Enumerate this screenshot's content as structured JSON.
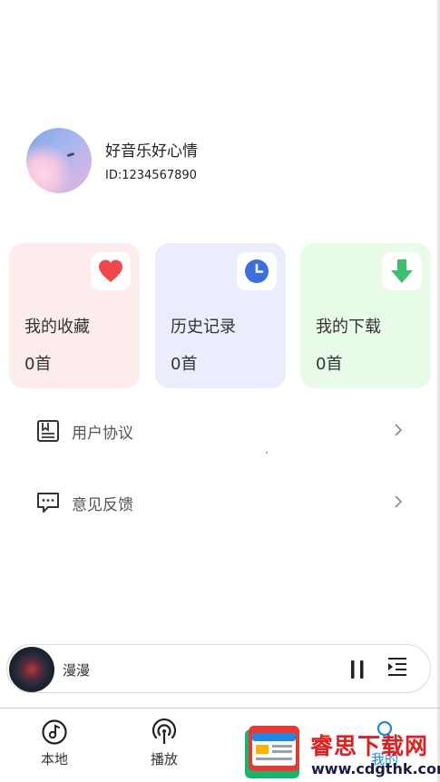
{
  "profile": {
    "username": "好音乐好心情",
    "user_id": "ID:1234567890"
  },
  "cards": {
    "favorites": {
      "label": "我的收藏",
      "count": "0首",
      "color": "#fdecec",
      "icon": "heart-icon"
    },
    "history": {
      "label": "历史记录",
      "count": "0首",
      "color": "#e9edfc",
      "icon": "clock-icon"
    },
    "downloads": {
      "label": "我的下载",
      "count": "0首",
      "color": "#e8fbe9",
      "icon": "download-icon"
    }
  },
  "menu": {
    "agreement_label": "用户协议",
    "feedback_label": "意见反馈"
  },
  "player": {
    "song_title": "漫漫"
  },
  "nav": {
    "local": "本地",
    "play": "播放",
    "mine": "我的",
    "active_color": "#1e88e5"
  },
  "watermark": {
    "title": "睿思下载网",
    "url": "www.cdgthk.com"
  }
}
